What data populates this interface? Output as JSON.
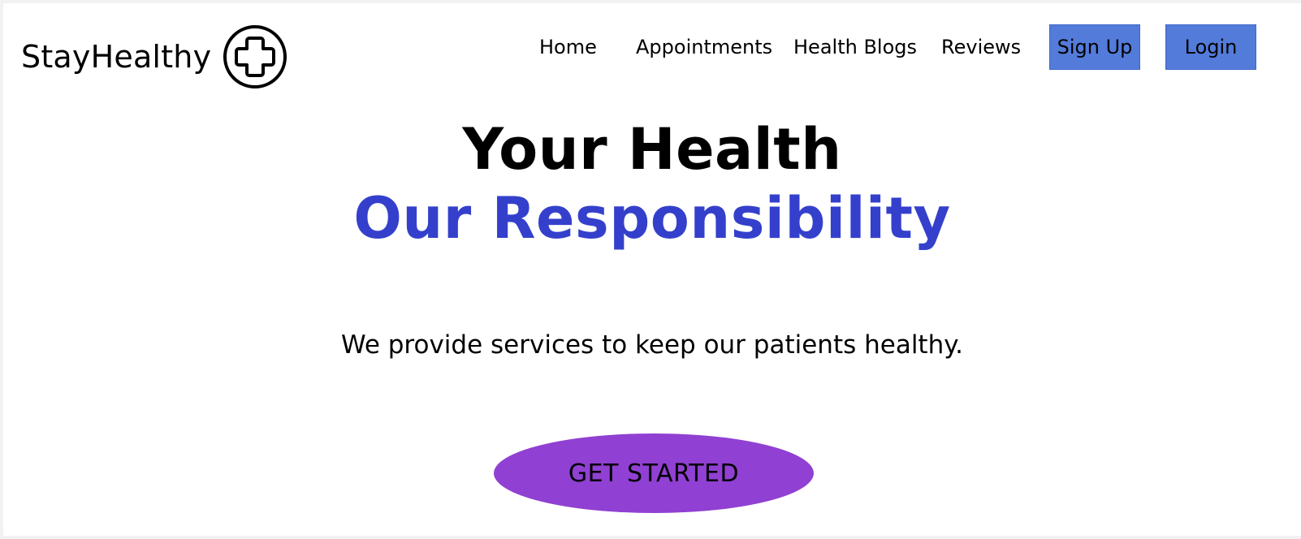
{
  "brand": {
    "name": "StayHealthy",
    "icon": "circle-plus-icon"
  },
  "nav": {
    "links": [
      "Home",
      "Appointments",
      "Health Blogs",
      "Reviews"
    ],
    "signup_label": "Sign Up",
    "login_label": "Login"
  },
  "hero": {
    "title_line1": "Your Health",
    "title_line2": "Our Responsibility",
    "subtitle": "We provide services to keep our patients healthy.",
    "cta_label": "GET STARTED"
  },
  "colors": {
    "background": "#ffffff",
    "outer_border": "#f2f2f2",
    "accent_text": "#3440cc",
    "nav_button": "#537bd9",
    "cta_button": "#9040d2"
  }
}
